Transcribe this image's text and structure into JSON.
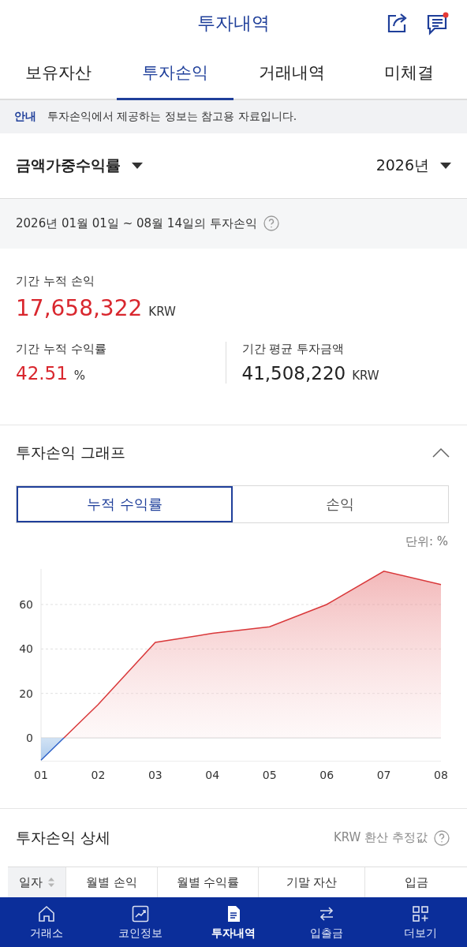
{
  "header": {
    "title": "투자내역",
    "notification": true
  },
  "tabs": [
    {
      "label": "보유자산",
      "selected": false
    },
    {
      "label": "투자손익",
      "selected": true
    },
    {
      "label": "거래내역",
      "selected": false
    },
    {
      "label": "미체결",
      "selected": false
    }
  ],
  "notice": {
    "tag": "안내",
    "text": "투자손익에서 제공하는 정보는 참고용 자료입니다."
  },
  "filters": {
    "method": "금액가중수익률",
    "year": "2026년"
  },
  "period": {
    "text": "2026년 01월 01일 ~ 08월 14일의 투자손익"
  },
  "summary": {
    "cumulative_pnl": {
      "label": "기간 누적 손익",
      "value": "17,658,322",
      "unit": "KRW"
    },
    "cumulative_return": {
      "label": "기간 누적 수익률",
      "value": "42.51",
      "unit": "%"
    },
    "avg_investment": {
      "label": "기간 평균 투자금액",
      "value": "41,508,220",
      "unit": "KRW"
    }
  },
  "graph": {
    "title": "투자손익 그래프",
    "expanded": true,
    "toggles": [
      {
        "label": "누적 수익률",
        "selected": true
      },
      {
        "label": "손익",
        "selected": false
      }
    ],
    "unit": "단위: %",
    "chart_data": {
      "type": "area",
      "categories": [
        "01",
        "02",
        "03",
        "04",
        "05",
        "06",
        "07",
        "08"
      ],
      "series": [
        {
          "color": "#d9383a",
          "values": [
            -10,
            15,
            43,
            47,
            50,
            60,
            75,
            69
          ]
        }
      ],
      "grid": true,
      "ylim": [
        -10.5,
        76
      ],
      "yticks": [
        0,
        20,
        40,
        60
      ]
    }
  },
  "detail": {
    "title": "투자손익 상세",
    "note": "KRW 환산 추정값",
    "columns": [
      {
        "label": "일자",
        "sortable": true
      },
      {
        "label": "월별 손익",
        "sortable": false
      },
      {
        "label": "월별 수익률",
        "sortable": false
      },
      {
        "label": "기말 자산",
        "sortable": false
      },
      {
        "label": "입금",
        "sortable": false
      }
    ]
  },
  "nav": [
    {
      "label": "거래소",
      "kind": "home",
      "selected": false
    },
    {
      "label": "코인정보",
      "kind": "chart",
      "selected": false
    },
    {
      "label": "투자내역",
      "kind": "doc",
      "selected": true
    },
    {
      "label": "입출금",
      "kind": "swap",
      "selected": false
    },
    {
      "label": "더보기",
      "kind": "more",
      "selected": false
    }
  ]
}
